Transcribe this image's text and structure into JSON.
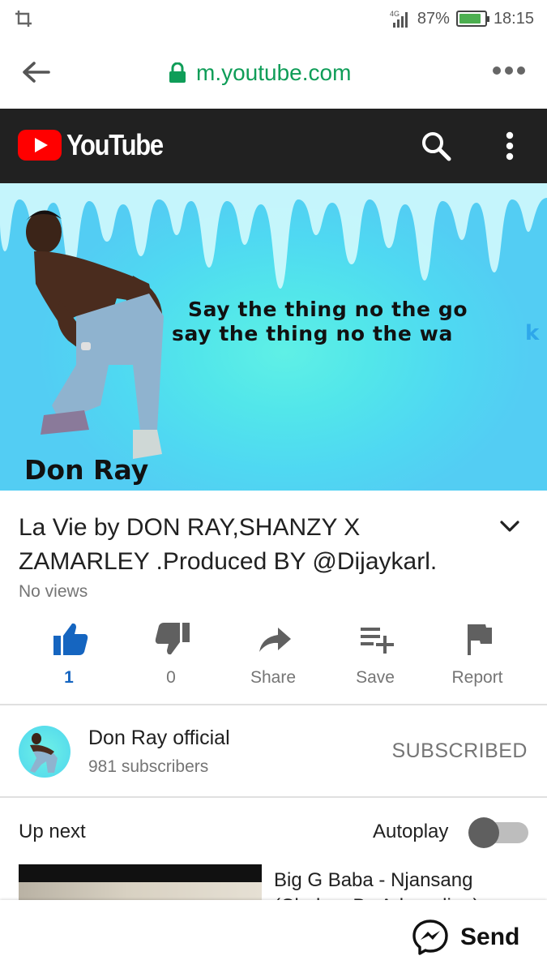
{
  "status_bar": {
    "network": "4G",
    "battery_percent": "87%",
    "battery_level": 0.87,
    "time": "18:15"
  },
  "browser": {
    "url": "m.youtube.com"
  },
  "header": {
    "logo_text": "YouTube",
    "brand_red": "#ff0000"
  },
  "video": {
    "caption_line1": "Say the thing no the go",
    "caption_line2": "say the thing no the wa",
    "caption_fragment": "k",
    "artist_overlay": "Don Ray"
  },
  "meta": {
    "title": "La Vie by DON RAY,SHANZY X ZAMARLEY .Produced BY @Dijaykarl.",
    "views": "No views"
  },
  "actions": {
    "like_count": "1",
    "dislike_count": "0",
    "share_label": "Share",
    "save_label": "Save",
    "report_label": "Report",
    "accent": "#1565c0"
  },
  "channel": {
    "name": "Don Ray official",
    "subscribers": "981 subscribers",
    "subscribe_state": "SUBSCRIBED"
  },
  "up_next": {
    "heading": "Up next",
    "autoplay_label": "Autoplay",
    "autoplay_on": false,
    "next_title": "Big G Baba - Njansang (Chokon By Adrenaline)"
  },
  "share_overlay": {
    "send_label": "Send"
  }
}
